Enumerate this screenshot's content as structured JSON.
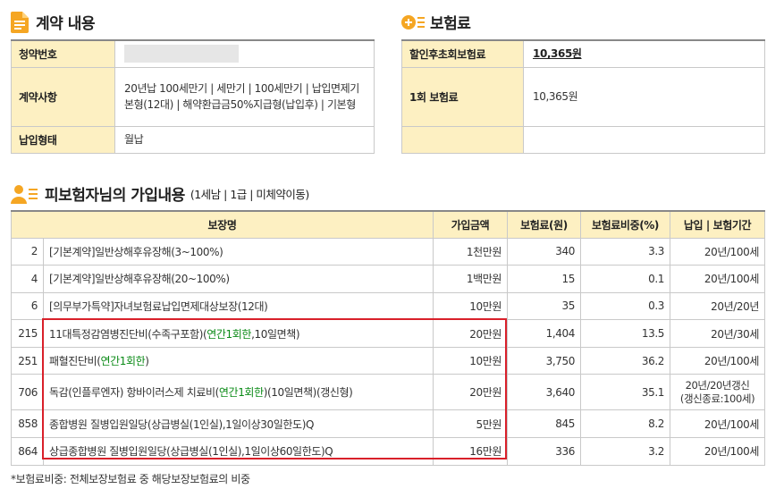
{
  "contract": {
    "title": "계약 내용",
    "rows": [
      {
        "label": "청약번호",
        "value": ""
      },
      {
        "label": "계약사항",
        "value": "20년납 100세만기 | 세만기 | 100세만기 | 납입면제기본형(12대) | 해약환급금50%지급형(납입후) | 기본형"
      },
      {
        "label": "납입형태",
        "value": "월납"
      }
    ]
  },
  "premium": {
    "title": "보험료",
    "rows": [
      {
        "label": "할인후초회보험료",
        "value": "10,365원"
      },
      {
        "label": "1회 보험료",
        "value": "10,365원"
      },
      {
        "label": "",
        "value": ""
      }
    ]
  },
  "coverage": {
    "title": "피보험자님의 가입내용",
    "subtitle": "(1세남 | 1급 | 미체약이동)",
    "headers": [
      "보장명",
      "가입금액",
      "보험료(원)",
      "보험료비중(%)",
      "납입 | 보험기간"
    ],
    "rows": [
      {
        "code": "2",
        "name": "[기본계약]일반상해후유장해(3~100%)",
        "amount": "1천만원",
        "premium": "340",
        "ratio": "3.3",
        "period": "20년/100세"
      },
      {
        "code": "4",
        "name": "[기본계약]일반상해후유장해(20~100%)",
        "amount": "1백만원",
        "premium": "15",
        "ratio": "0.1",
        "period": "20년/100세"
      },
      {
        "code": "6",
        "name": "[의무부가특약]자녀보험료납입면제대상보장(12대)",
        "amount": "10만원",
        "premium": "35",
        "ratio": "0.3",
        "period": "20년/20년"
      },
      {
        "code": "215",
        "name_pre": "11대특정감염병진단비(수족구포함)(",
        "name_hl": "연간1회한",
        "name_post": ",10일면책)",
        "amount": "20만원",
        "premium": "1,404",
        "ratio": "13.5",
        "period": "20년/30세"
      },
      {
        "code": "251",
        "name_pre": "패혈진단비(",
        "name_hl": "연간1회한",
        "name_post": ")",
        "amount": "10만원",
        "premium": "3,750",
        "ratio": "36.2",
        "period": "20년/100세"
      },
      {
        "code": "706",
        "name_pre": "독감(인플루엔자) 항바이러스제 치료비(",
        "name_hl": "연간1회한",
        "name_post": ")(10일면책)(갱신형)",
        "amount": "20만원",
        "premium": "3,640",
        "ratio": "35.1",
        "period": "20년/20년갱신",
        "period2": "(갱신종료:100세)"
      },
      {
        "code": "858",
        "name": "종합병원 질병입원일당(상급병실(1인실),1일이상30일한도)Q",
        "amount": "5만원",
        "premium": "845",
        "ratio": "8.2",
        "period": "20년/100세"
      },
      {
        "code": "864",
        "name": "상급종합병원 질병입원일당(상급병실(1인실),1일이상60일한도)Q",
        "amount": "16만원",
        "premium": "336",
        "ratio": "3.2",
        "period": "20년/100세"
      }
    ]
  },
  "footnote": "*보험료비중: 전체보장보험료 중 해당보장보험료의 비중",
  "colors": {
    "accent": "#f5a623",
    "header_bg": "#fdf0c2",
    "highlight": "#0a8a16",
    "box": "#d9202a"
  }
}
